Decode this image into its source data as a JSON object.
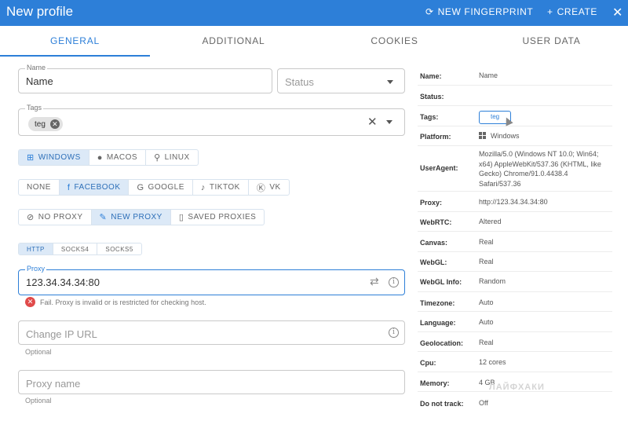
{
  "header": {
    "title": "New profile",
    "new_fingerprint": "NEW FINGERPRINT",
    "create": "CREATE",
    "close_glyph": "✕"
  },
  "tabs": [
    "GENERAL",
    "ADDITIONAL",
    "COOKIES",
    "USER DATA"
  ],
  "form": {
    "name_label": "Name",
    "name_value": "Name",
    "status_placeholder": "Status",
    "tags_label": "Tags",
    "tag_chip": "teg",
    "os_options": [
      "WINDOWS",
      "MACOS",
      "LINUX"
    ],
    "os_selected": "WINDOWS",
    "template_options": [
      "NONE",
      "FACEBOOK",
      "GOOGLE",
      "TIKTOK",
      "VK"
    ],
    "template_selected": "FACEBOOK",
    "proxy_mode_options": [
      "NO PROXY",
      "NEW PROXY",
      "SAVED PROXIES"
    ],
    "proxy_mode_selected": "NEW PROXY",
    "proxy_type_options": [
      "HTTP",
      "SOCKS4",
      "SOCKS5"
    ],
    "proxy_type_selected": "HTTP",
    "proxy_label": "Proxy",
    "proxy_value": "123.34.34.34:80",
    "proxy_error": "Fail. Proxy is invalid or is restricted for checking host.",
    "change_ip_placeholder": "Change IP URL",
    "change_ip_helper": "Optional",
    "proxy_name_placeholder": "Proxy name",
    "proxy_name_helper": "Optional"
  },
  "summary": [
    {
      "key": "Name:",
      "value": "Name"
    },
    {
      "key": "Status:",
      "value": ""
    },
    {
      "key": "Tags:",
      "value": "teg"
    },
    {
      "key": "Platform:",
      "value": "Windows"
    },
    {
      "key": "UserAgent:",
      "value": "Mozilla/5.0 (Windows NT 10.0; Win64; x64) AppleWebKit/537.36 (KHTML, like Gecko) Chrome/91.0.4438.4 Safari/537.36"
    },
    {
      "key": "Proxy:",
      "value": "http://123.34.34.34:80"
    },
    {
      "key": "WebRTC:",
      "value": "Altered"
    },
    {
      "key": "Canvas:",
      "value": "Real"
    },
    {
      "key": "WebGL:",
      "value": "Real"
    },
    {
      "key": "WebGL Info:",
      "value": "Random"
    },
    {
      "key": "Timezone:",
      "value": "Auto"
    },
    {
      "key": "Language:",
      "value": "Auto"
    },
    {
      "key": "Geolocation:",
      "value": "Real"
    },
    {
      "key": "Cpu:",
      "value": "12 cores"
    },
    {
      "key": "Memory:",
      "value": "4 GB"
    },
    {
      "key": "Do not track:",
      "value": "Off"
    }
  ],
  "watermark": "ЛАЙФХАКИ",
  "colors": {
    "accent": "#2d7fd8",
    "error": "#e04a4a"
  }
}
